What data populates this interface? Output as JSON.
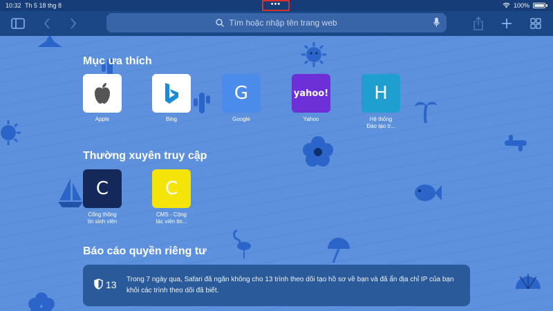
{
  "status_bar": {
    "time": "10:32",
    "date": "Th 5 18 thg 8",
    "battery": "100%",
    "more_dots": "•••"
  },
  "toolbar": {
    "search_placeholder": "Tìm hoặc nhập tên trang web"
  },
  "favorites": {
    "title": "Mục ưa thích",
    "items": [
      {
        "label": "Apple",
        "icon": "apple-logo"
      },
      {
        "label": "Bing",
        "icon": "bing-logo"
      },
      {
        "label": "Google",
        "letter": "G"
      },
      {
        "label": "Yahoo",
        "logo_text": "yahoo!"
      },
      {
        "label": "Hệ thống\nĐào tạo tr...",
        "letter": "H"
      }
    ]
  },
  "frequent": {
    "title": "Thường xuyên truy cập",
    "items": [
      {
        "label": "Cổng thông\ntin sinh viên",
        "letter": "C"
      },
      {
        "label": "CMS - Cộng\ntác viên tin...",
        "letter": "C"
      }
    ]
  },
  "privacy": {
    "title": "Báo cáo quyền riêng tư",
    "count": "13",
    "text": "Trong 7 ngày qua, Safari đã ngăn không cho 13 trình theo dõi tạo hồ sơ về bạn và đã ẩn địa chỉ IP của bạn khỏi các trình theo dõi đã biết."
  },
  "colors": {
    "toolbar": "#1b4786",
    "status_bar": "#163d77",
    "background": "#5d91de",
    "highlight": "#d9302f"
  }
}
